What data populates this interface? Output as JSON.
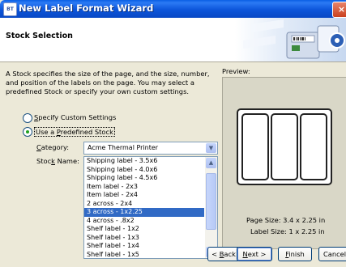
{
  "window": {
    "title": "New Label Format Wizard",
    "close": "×"
  },
  "header": {
    "title": "Stock Selection"
  },
  "description": "A Stock specifies the size of the page, and the size, number, and position of the labels on the page. You may select a predefined Stock or specify your own custom settings.",
  "options": {
    "custom": {
      "label_pre": "",
      "label_mn": "S",
      "label_post": "pecify Custom Settings",
      "checked": false
    },
    "predefined": {
      "label_pre": "Use a ",
      "label_mn": "P",
      "label_post": "redefined Stock",
      "checked": true
    }
  },
  "category": {
    "label_mn": "C",
    "label_post": "ategory:",
    "value": "Acme Thermal Printer"
  },
  "stock_name": {
    "label_pre": "Stoc",
    "label_mn": "k",
    "label_post": " Name:",
    "items": [
      "Shipping label - 3.5x6",
      "Shipping label - 4.0x6",
      "Shipping label - 4.5x6",
      "Item label - 2x3",
      "Item label - 2x4",
      "2 across - 2x4",
      "3 across - 1x2.25",
      "4 across - .8x2",
      "Shelf label - 1x2",
      "Shelf label - 1x3",
      "Shelf label - 1x4",
      "Shelf label - 1x5"
    ],
    "selected_index": 6
  },
  "preview": {
    "label": "Preview:",
    "page_size": "Page Size:  3.4 x 2.25 in",
    "label_size": "Label Size:  1 x 2.25 in",
    "label_count": 3
  },
  "buttons": {
    "back": {
      "pre": "< ",
      "mn": "B",
      "post": "ack"
    },
    "next": {
      "pre": "",
      "mn": "N",
      "post": "ext >"
    },
    "finish": {
      "pre": "",
      "mn": "F",
      "post": "inish"
    },
    "cancel": "Cancel"
  },
  "icons": {
    "title": "wizard-app-icon",
    "scroll_up": "chevron-up-icon",
    "scroll_down": "chevron-down-icon",
    "dropdown": "chevron-down-icon"
  }
}
